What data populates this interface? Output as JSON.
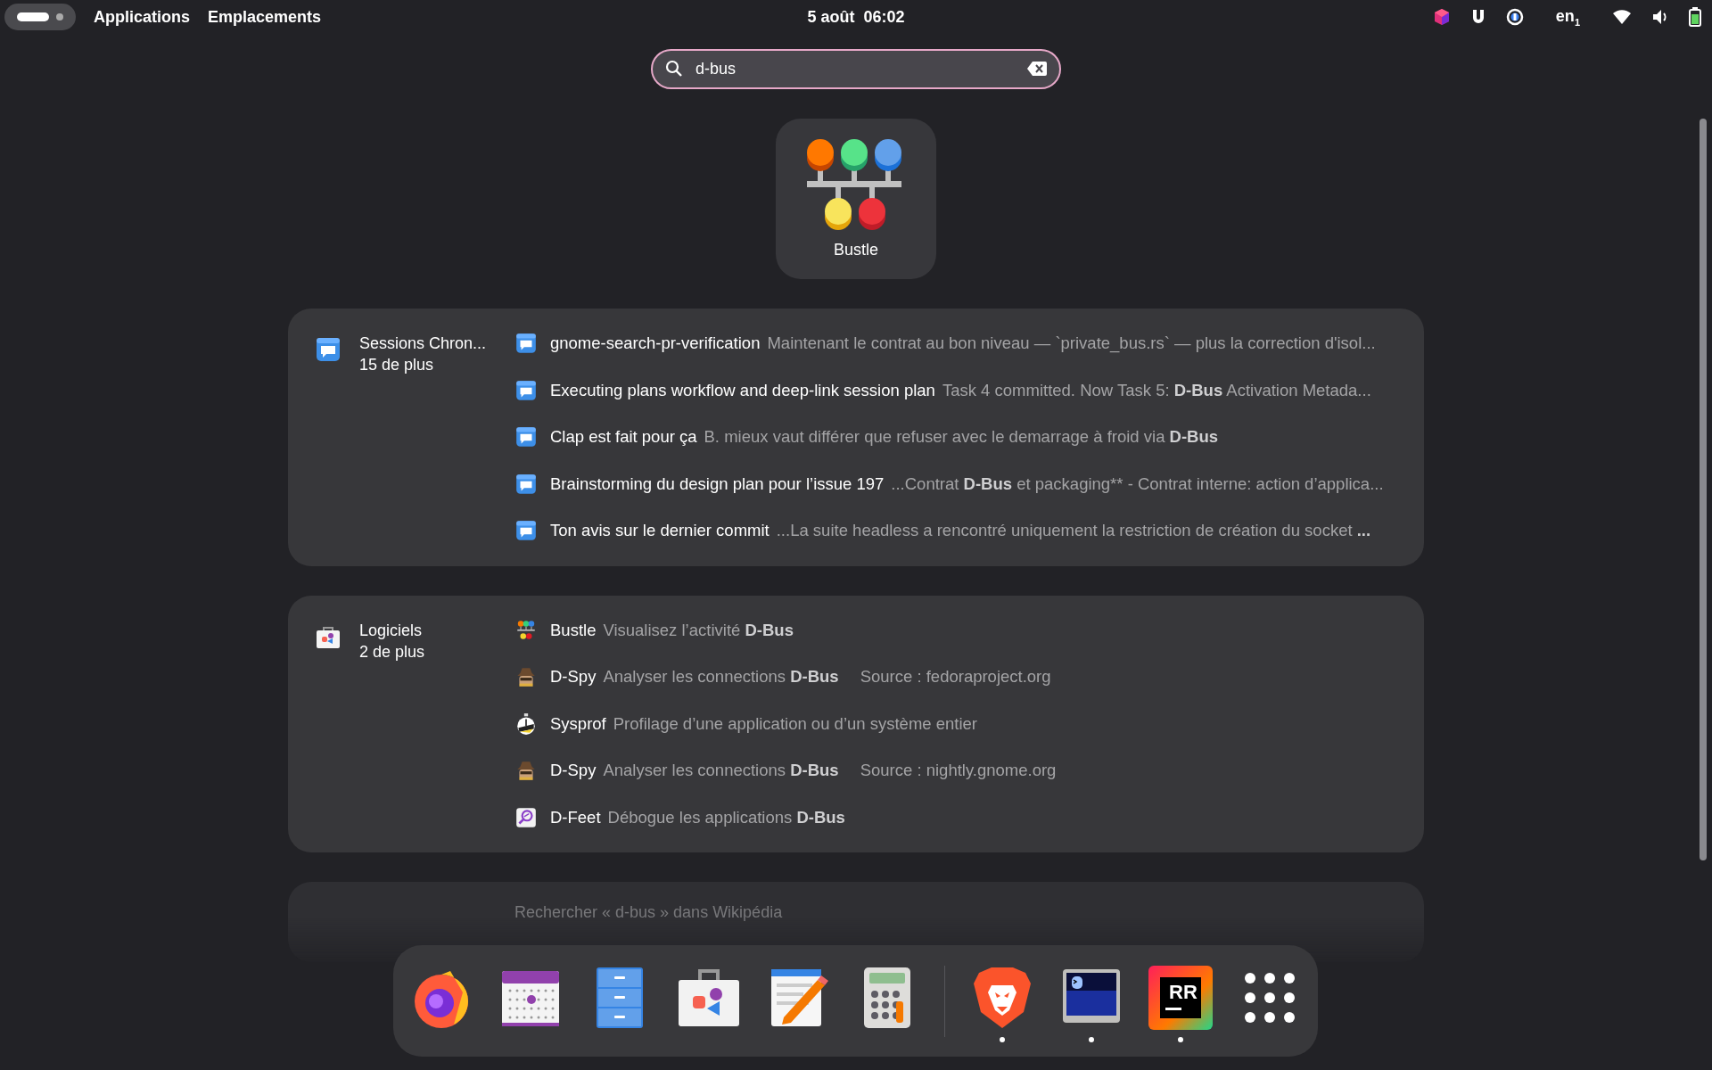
{
  "top_bar": {
    "workspaces": [
      {
        "selected": true
      },
      {
        "selected": false
      }
    ],
    "menus": [
      "Applications",
      "Emplacements"
    ],
    "clock": "5 août  06:02",
    "tray": [
      {
        "kind": "cube"
      },
      {
        "kind": "magnet"
      },
      {
        "kind": "badge"
      },
      {
        "kind": "keyboard",
        "label": "en$_{1}$"
      },
      {
        "kind": "wifi"
      },
      {
        "kind": "volume"
      },
      {
        "kind": "battery"
      }
    ]
  },
  "search": {
    "value": "d-bus"
  },
  "top_app": {
    "name": "Bustle"
  },
  "sections": [
    {
      "kind": "sessions",
      "title": "Sessions Chron...",
      "more": "15 de plus",
      "results": [
        {
          "kind": "chat",
          "title": "gnome-search-pr-verification",
          "description": "Maintenant le contrat au bon niveau — `private_bus.rs` — plus la correction d'isol..."
        },
        {
          "kind": "chat",
          "title": "Executing plans workflow and deep-link session plan",
          "description": "Task 4 committed. Now Task 5: **D-Bus** Activation Metada..."
        },
        {
          "kind": "chat",
          "title": "Clap est fait pour ça",
          "description": "B. mieux vaut différer que refuser avec le demarrage à froid via **D-Bus**"
        },
        {
          "kind": "chat",
          "title": "Brainstorming du design plan pour l’issue 197",
          "description": "...Contrat **D-Bus** et packaging** - Contrat interne: action d’applica..."
        },
        {
          "kind": "chat",
          "title": "Ton avis sur le dernier commit",
          "description": "...La suite headless a rencontré uniquement la restriction de création du socket **...**"
        }
      ]
    },
    {
      "kind": "software",
      "title": "Logiciels",
      "more": "2 de plus",
      "results": [
        {
          "kind": "bus",
          "title": "Bustle",
          "description": "Visualisez l’activité **D-Bus**"
        },
        {
          "kind": "spy",
          "title": "D-Spy",
          "description": "Analyser les connections **D-Bus**",
          "source": "Source : fedoraproject.org"
        },
        {
          "kind": "stopwatch",
          "title": "Sysprof",
          "description": "Profilage d’une application ou d’un système entier"
        },
        {
          "kind": "spy",
          "title": "D-Spy",
          "description": "Analyser les connections **D-Bus**",
          "source": "Source : nightly.gnome.org"
        },
        {
          "kind": "magnifier",
          "title": "D-Feet",
          "description": "Débogue les applications **D-Bus**"
        }
      ]
    }
  ],
  "partial_section": {
    "text": "Rechercher « d-bus » dans Wikipédia"
  },
  "dock": {
    "items": [
      {
        "kind": "firefox",
        "running": false
      },
      {
        "kind": "calendar",
        "running": false
      },
      {
        "kind": "files",
        "running": false
      },
      {
        "kind": "software",
        "running": false
      },
      {
        "kind": "editor",
        "running": false
      },
      {
        "kind": "calculator",
        "running": false
      },
      {
        "kind": "separator"
      },
      {
        "kind": "brave",
        "running": true
      },
      {
        "kind": "terminal",
        "running": true
      },
      {
        "kind": "rider",
        "running": true,
        "label": "RR"
      },
      {
        "kind": "grid",
        "running": false
      }
    ]
  }
}
